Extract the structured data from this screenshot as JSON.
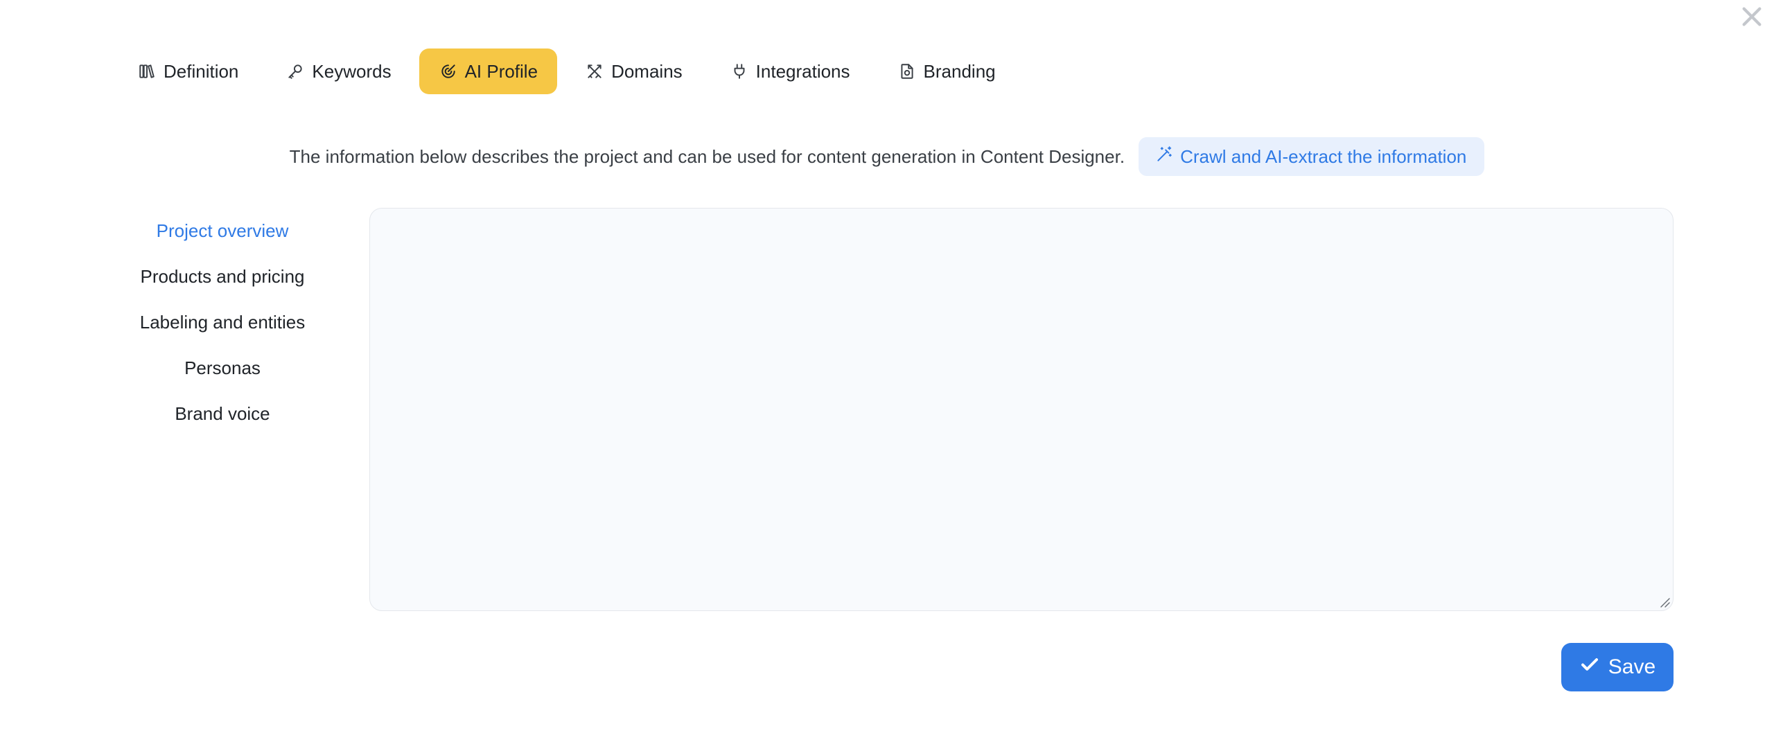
{
  "tabs": [
    {
      "label": "Definition",
      "icon": "books-icon",
      "active": false
    },
    {
      "label": "Keywords",
      "icon": "key-icon",
      "active": false
    },
    {
      "label": "AI Profile",
      "icon": "target-icon",
      "active": true
    },
    {
      "label": "Domains",
      "icon": "swords-icon",
      "active": false
    },
    {
      "label": "Integrations",
      "icon": "plug-icon",
      "active": false
    },
    {
      "label": "Branding",
      "icon": "file-brand-icon",
      "active": false
    }
  ],
  "info": {
    "text": "The information below describes the project and can be used for content generation in Content Designer.",
    "crawl_label": "Crawl and AI-extract the information"
  },
  "sections": [
    {
      "label": "Project overview",
      "active": true
    },
    {
      "label": "Products and pricing",
      "active": false
    },
    {
      "label": "Labeling and entities",
      "active": false
    },
    {
      "label": "Personas",
      "active": false
    },
    {
      "label": "Brand voice",
      "active": false
    }
  ],
  "editor": {
    "value": "",
    "placeholder": ""
  },
  "save_label": "Save",
  "colors": {
    "active_tab": "#f6c745",
    "accent": "#2f7ae5",
    "crawl_bg": "#e8f0fd",
    "editor_bg": "#f8fafd"
  }
}
